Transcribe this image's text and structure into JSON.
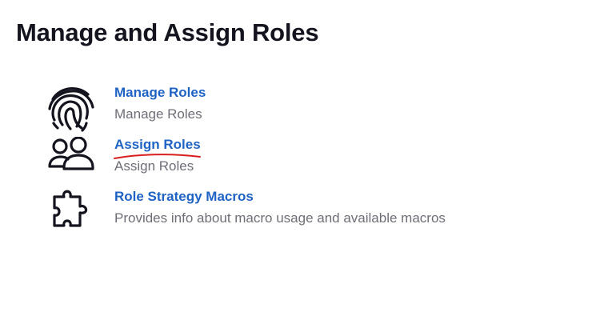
{
  "page": {
    "title": "Manage and Assign Roles"
  },
  "items": [
    {
      "title": "Manage Roles",
      "description": "Manage Roles",
      "icon": "fingerprint-icon"
    },
    {
      "title": "Assign Roles",
      "description": "Assign Roles",
      "icon": "users-icon"
    },
    {
      "title": "Role Strategy Macros",
      "description": "Provides info about macro usage and available macros",
      "icon": "puzzle-icon"
    }
  ],
  "colors": {
    "link": "#1f63c4",
    "description": "#6e6e77",
    "heading": "#14141f",
    "annotation_underline": "#d81e1e"
  }
}
